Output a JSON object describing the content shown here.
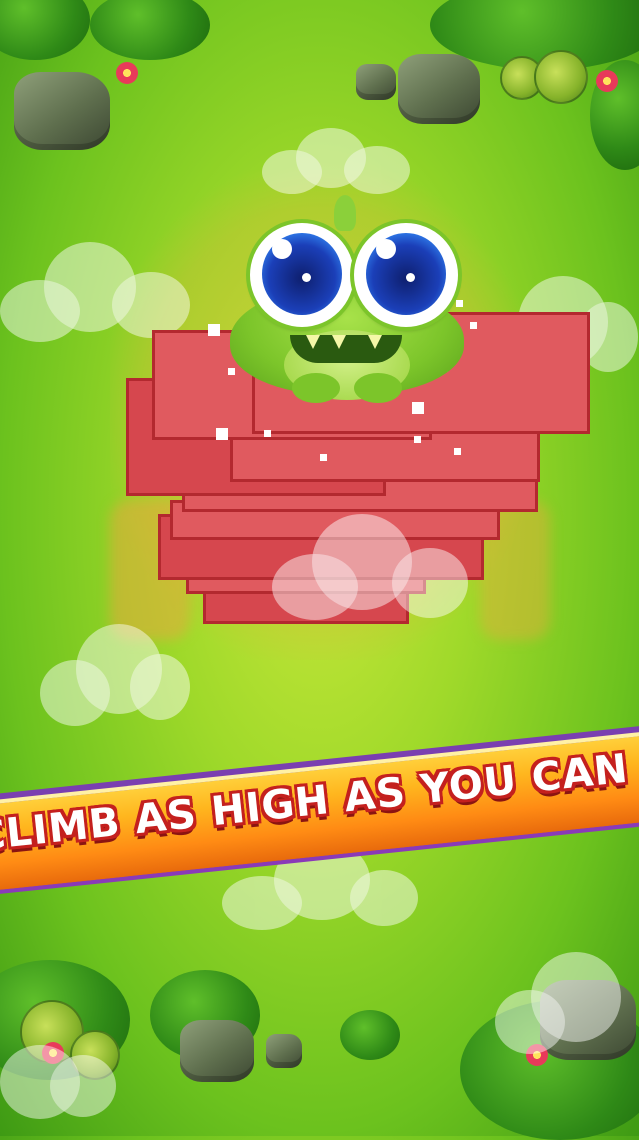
{
  "screen": {
    "name": "game-promo-screen"
  },
  "banner": {
    "text": "CLIMB AS HIGH AS YOU CAN !",
    "colors": {
      "band": "#ff9a1a",
      "text": "#ffffff",
      "outline": "#c4201e",
      "trim": "#7a3fb0"
    }
  },
  "tower": {
    "block_color": "#e05a5f",
    "block_border": "#b3292f"
  },
  "character": {
    "type": "green-alien-frog",
    "body_color": "#7cc52a",
    "eye_color": "#1b3fb8"
  },
  "background": {
    "ground": "grass",
    "accent": "#9fd92a"
  }
}
